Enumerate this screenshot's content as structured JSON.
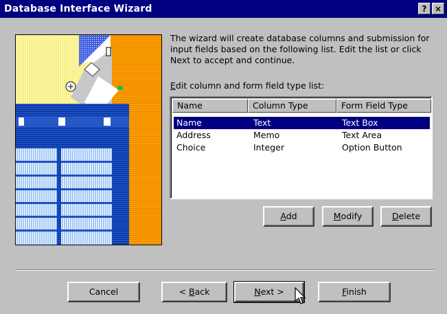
{
  "window": {
    "title": "Database Interface Wizard",
    "help_label": "?",
    "close_label": "×"
  },
  "intro_text": "The wizard will create database columns and submission for input fields based on the following list.  Edit the list or click Next to accept and continue.",
  "list_label": {
    "accel": "E",
    "rest": "dit column and form field type list:"
  },
  "columns": [
    "Name",
    "Column Type",
    "Form Field Type"
  ],
  "rows": [
    {
      "name": "Name",
      "column_type": "Text",
      "field_type": "Text Box",
      "selected": true
    },
    {
      "name": "Address",
      "column_type": "Memo",
      "field_type": "Text Area",
      "selected": false
    },
    {
      "name": "Choice",
      "column_type": "Integer",
      "field_type": "Option Button",
      "selected": false
    }
  ],
  "list_buttons": {
    "add": {
      "accel": "A",
      "rest": "dd"
    },
    "modify": {
      "accel": "M",
      "rest": "odify"
    },
    "delete": {
      "accel": "D",
      "rest": "elete"
    }
  },
  "nav_buttons": {
    "cancel": "Cancel",
    "back": {
      "prefix": "< ",
      "accel": "B",
      "rest": "ack"
    },
    "next": {
      "accel": "N",
      "rest": "ext >"
    },
    "finish": {
      "accel": "F",
      "rest": "inish"
    }
  },
  "colors": {
    "titlebar": "#000080",
    "selection": "#000080",
    "face": "#c0c0c0"
  }
}
